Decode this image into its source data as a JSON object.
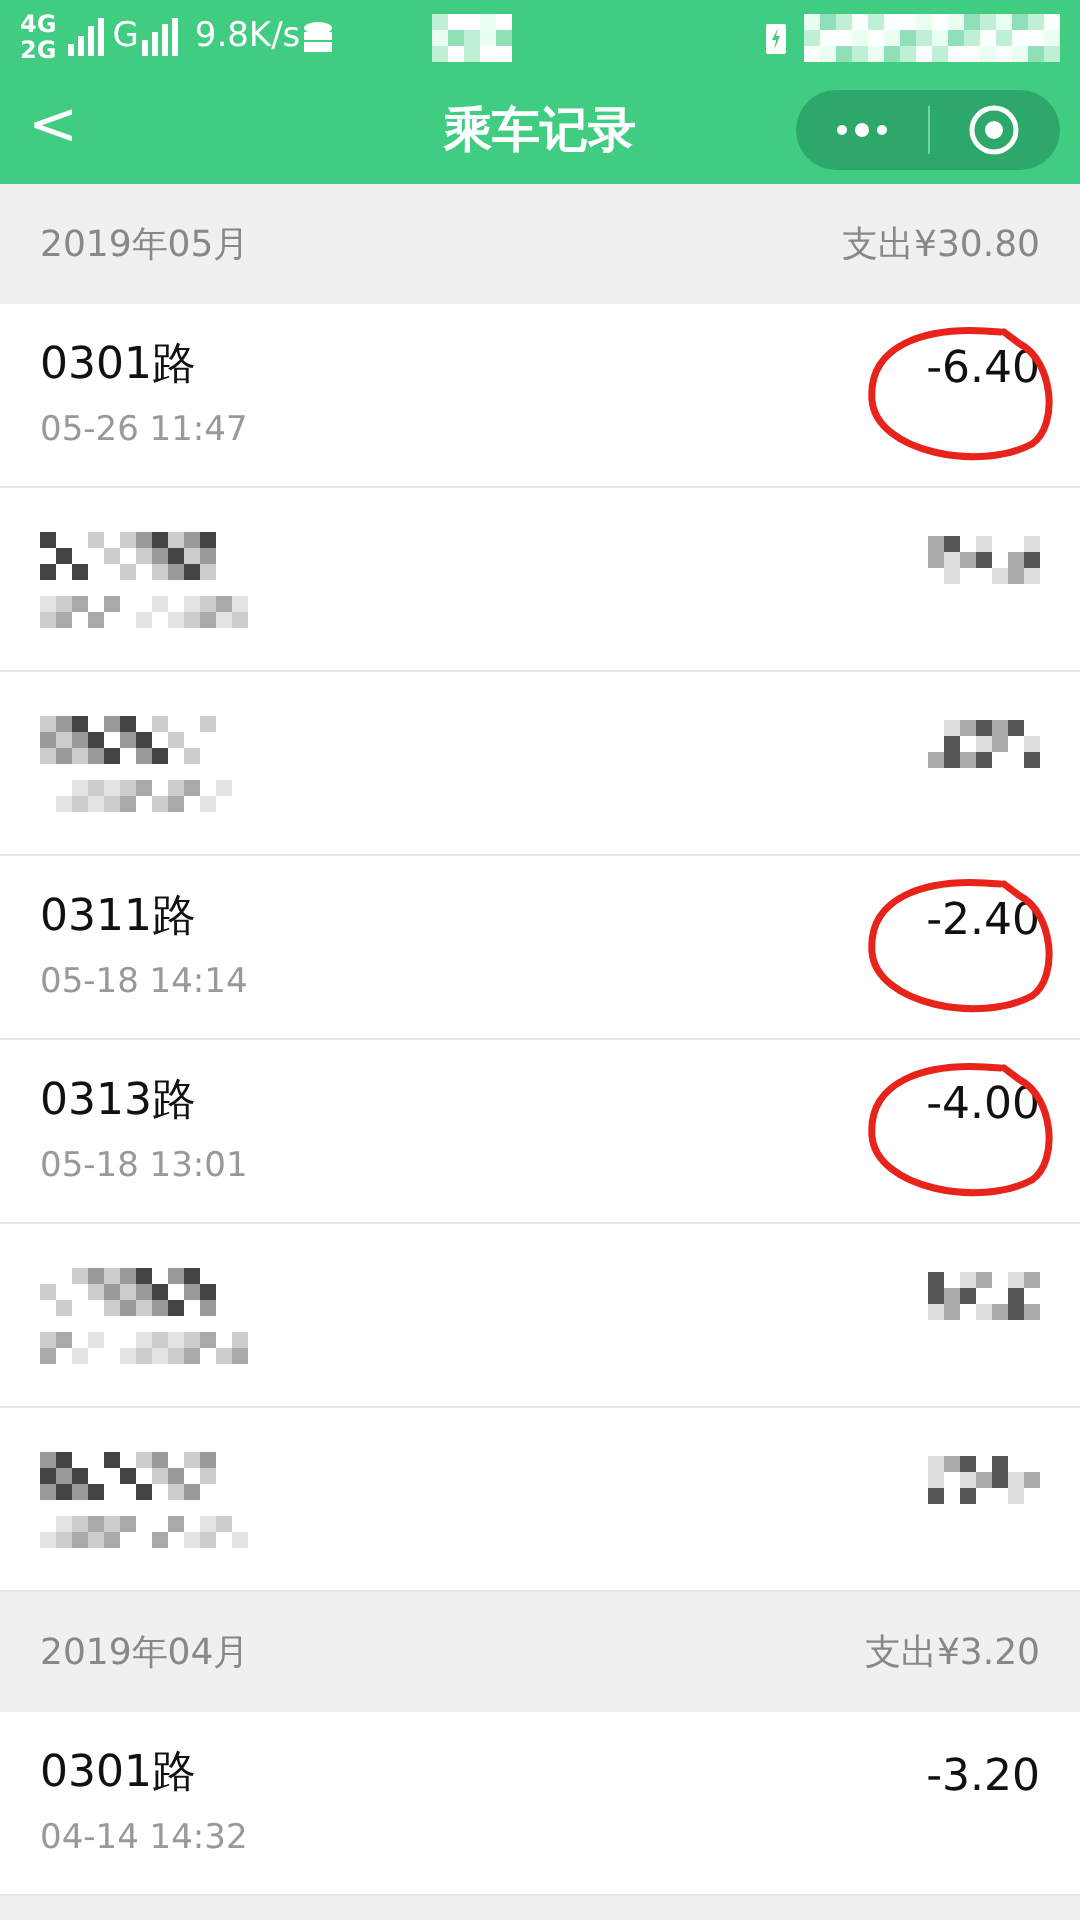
{
  "status_bar": {
    "network_top": "4G",
    "network_bottom": "2G",
    "network_3": "G",
    "speed": "9.8K/s"
  },
  "header": {
    "back": "<",
    "title": "乘车记录"
  },
  "groups": [
    {
      "month": "2019年05月",
      "total": "支出¥30.80",
      "rows": [
        {
          "kind": "trip",
          "route": "0301路",
          "time": "05-26 11:47",
          "amount": "-6.40",
          "circled": true
        },
        {
          "kind": "redacted"
        },
        {
          "kind": "redacted"
        },
        {
          "kind": "trip",
          "route": "0311路",
          "time": "05-18 14:14",
          "amount": "-2.40",
          "circled": true
        },
        {
          "kind": "trip",
          "route": "0313路",
          "time": "05-18 13:01",
          "amount": "-4.00",
          "circled": true
        },
        {
          "kind": "redacted"
        },
        {
          "kind": "redacted"
        }
      ]
    },
    {
      "month": "2019年04月",
      "total": "支出¥3.20",
      "rows": [
        {
          "kind": "trip",
          "route": "0301路",
          "time": "04-14 14:32",
          "amount": "-3.20",
          "circled": false
        }
      ]
    }
  ]
}
